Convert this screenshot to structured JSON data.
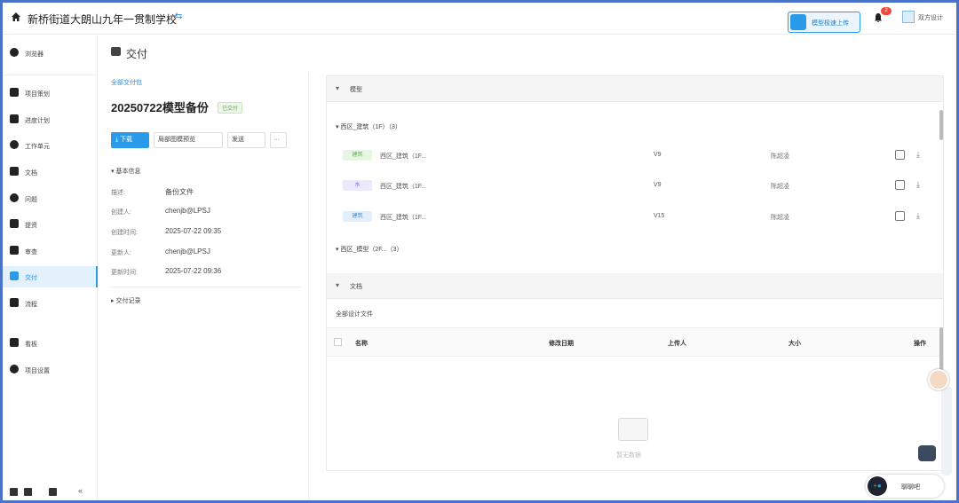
{
  "topbar": {
    "project_title": "新桥街道大朗山九年一贯制学校",
    "swap_glyph": "⇆",
    "upload_label": "模型极速上传",
    "notification_count": "2",
    "user_name": "双方设计"
  },
  "sidebar": {
    "items": [
      {
        "label": "浏览器",
        "icon": "browser-icon"
      },
      {
        "label": "项目策划",
        "icon": "flag-icon"
      },
      {
        "label": "进度计划",
        "icon": "schedule-icon"
      },
      {
        "label": "工作单元",
        "icon": "globe-icon"
      },
      {
        "label": "文档",
        "icon": "document-icon"
      },
      {
        "label": "问题",
        "icon": "question-icon"
      },
      {
        "label": "提资",
        "icon": "folder-icon"
      },
      {
        "label": "审查",
        "icon": "review-icon"
      },
      {
        "label": "交付",
        "icon": "deliver-icon",
        "active": true
      },
      {
        "label": "流程",
        "icon": "flow-icon"
      },
      {
        "label": "看板",
        "icon": "dashboard-icon"
      },
      {
        "label": "项目设置",
        "icon": "gear-icon"
      }
    ],
    "collapse_glyph": "«"
  },
  "page": {
    "title": "交付"
  },
  "detail": {
    "all_link": "全部交付包",
    "version_title": "20250722模型备份",
    "status_tag": "已交付",
    "buttons": {
      "download": "下载",
      "preview": "局部图模预览",
      "send": "发送",
      "more": "···"
    },
    "basic_info_heading": "基本信息",
    "fields": [
      {
        "key": "描述:",
        "value": "备份文件"
      },
      {
        "key": "创建人:",
        "value": "chenjb@LPSJ"
      },
      {
        "key": "创建时间:",
        "value": "2025-07-22 09:35"
      },
      {
        "key": "更新人:",
        "value": "chenjb@LPSJ"
      },
      {
        "key": "更新时间:",
        "value": "2025-07-22 09:36"
      }
    ],
    "records_heading": "交付记录"
  },
  "content": {
    "model_section": "模型",
    "tree1": "西区_建筑（1F）（3）",
    "rows": [
      {
        "tag": "建筑",
        "tag_bg": "#e7f6e3",
        "tag_fg": "#5bb34a",
        "name": "西区_建筑（1F...",
        "version": "V9",
        "who": "陈超凌"
      },
      {
        "tag": "水",
        "tag_bg": "#ebe9fb",
        "tag_fg": "#7d6fd6",
        "name": "西区_建筑（1F...",
        "version": "V9",
        "who": "陈超凌"
      },
      {
        "tag": "建筑",
        "tag_bg": "#e3f0fb",
        "tag_fg": "#3d8fd8",
        "name": "西区_建筑（1F...",
        "version": "V15",
        "who": "陈超凌"
      }
    ],
    "tree2": "西区_模型（2F...（3）",
    "doc_section": "文档",
    "doc_sub": "全部设计文件",
    "columns": [
      "名称",
      "修改日期",
      "上传人",
      "大小",
      "操作"
    ],
    "empty_text": "暂无数据"
  },
  "floating": {
    "chat_label": "聊聊吧"
  },
  "icons": {
    "download": "⤓",
    "chevron": "▾",
    "caret": "▸"
  }
}
